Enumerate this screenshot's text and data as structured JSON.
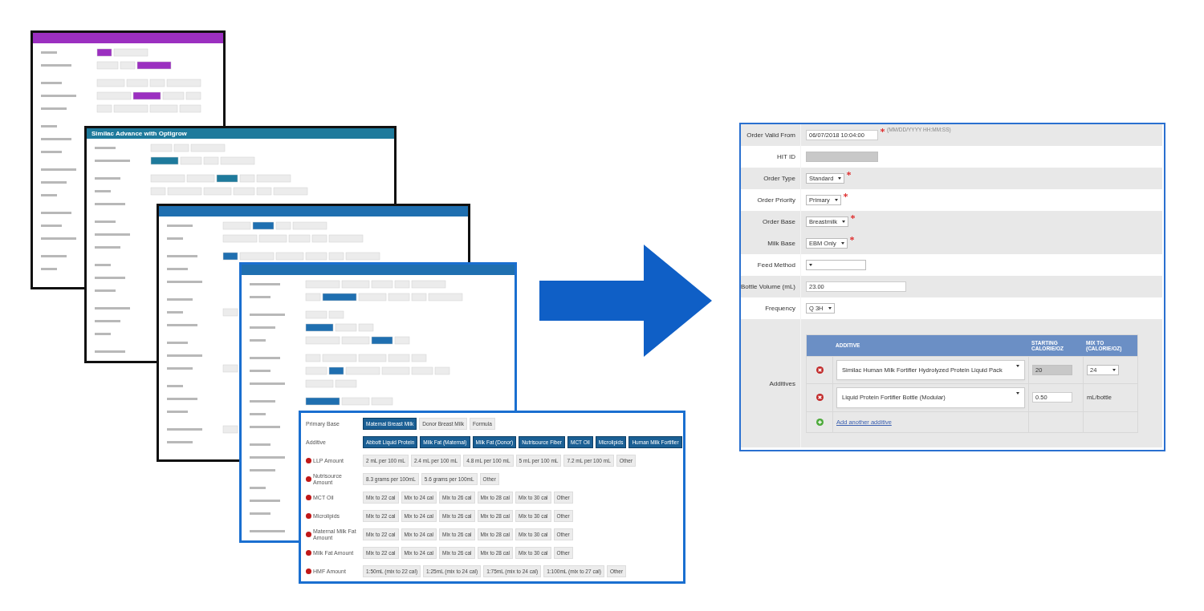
{
  "background_windows": [
    {
      "color": "#9b2fc0"
    },
    {
      "color": "#1e7a9c",
      "title": "Similac Advance with Optigrow"
    },
    {
      "color": "#1f6fb0"
    },
    {
      "color": "#1f6fb0"
    }
  ],
  "additive_window": {
    "rows": [
      {
        "label": "Primary Base",
        "required": false,
        "options": [
          {
            "label": "Maternal Breast Milk",
            "selected": true
          },
          {
            "label": "Donor Breast Milk",
            "selected": false
          },
          {
            "label": "Formula",
            "selected": false
          }
        ]
      },
      {
        "label": "Additive",
        "required": false,
        "options": [
          {
            "label": "Abbott Liquid Protein",
            "selected": true
          },
          {
            "label": "Milk Fat (Maternal)",
            "selected": true
          },
          {
            "label": "Milk Fat (Donor)",
            "selected": true
          },
          {
            "label": "Nutrisource Fiber",
            "selected": true
          },
          {
            "label": "MCT Oil",
            "selected": true
          },
          {
            "label": "Microlipids",
            "selected": true
          },
          {
            "label": "Human Milk Fortifier",
            "selected": true
          }
        ]
      },
      {
        "label": "LLP Amount",
        "required": true,
        "options": [
          {
            "label": "2 mL per 100 mL",
            "selected": false
          },
          {
            "label": "2.4 mL per 100 mL",
            "selected": false
          },
          {
            "label": "4.8 mL per 100 mL",
            "selected": false
          },
          {
            "label": "5 mL per 100 mL",
            "selected": false
          },
          {
            "label": "7.2 mL per 100 mL",
            "selected": false
          },
          {
            "label": "Other",
            "selected": false
          }
        ]
      },
      {
        "label": "Nutrisource Amount",
        "required": true,
        "options": [
          {
            "label": "8.3 grams per 100mL",
            "selected": false
          },
          {
            "label": "5.6 grams per 100mL",
            "selected": false
          },
          {
            "label": "Other",
            "selected": false
          }
        ]
      },
      {
        "label": "MCT Oil",
        "required": true,
        "options": [
          {
            "label": "Mix to 22 cal",
            "selected": false
          },
          {
            "label": "Mix to 24 cal",
            "selected": false
          },
          {
            "label": "Mix to 26 cal",
            "selected": false
          },
          {
            "label": "Mix to 28 cal",
            "selected": false
          },
          {
            "label": "Mix to 30 cal",
            "selected": false
          },
          {
            "label": "Other",
            "selected": false
          }
        ]
      },
      {
        "label": "Microlipids",
        "required": true,
        "options": [
          {
            "label": "Mix to 22 cal",
            "selected": false
          },
          {
            "label": "Mix to 24 cal",
            "selected": false
          },
          {
            "label": "Mix to 26 cal",
            "selected": false
          },
          {
            "label": "Mix to 28 cal",
            "selected": false
          },
          {
            "label": "Mix to 30 cal",
            "selected": false
          },
          {
            "label": "Other",
            "selected": false
          }
        ]
      },
      {
        "label": "Maternal Milk Fat Amount",
        "required": true,
        "options": [
          {
            "label": "Mix to 22 cal",
            "selected": false
          },
          {
            "label": "Mix to 24 cal",
            "selected": false
          },
          {
            "label": "Mix to 26 cal",
            "selected": false
          },
          {
            "label": "Mix to 28 cal",
            "selected": false
          },
          {
            "label": "Mix to 30 cal",
            "selected": false
          },
          {
            "label": "Other",
            "selected": false
          }
        ]
      },
      {
        "label": "Milk Fat Amount",
        "required": true,
        "options": [
          {
            "label": "Mix to 22 cal",
            "selected": false
          },
          {
            "label": "Mix to 24 cal",
            "selected": false
          },
          {
            "label": "Mix to 26 cal",
            "selected": false
          },
          {
            "label": "Mix to 28 cal",
            "selected": false
          },
          {
            "label": "Mix to 30 cal",
            "selected": false
          },
          {
            "label": "Other",
            "selected": false
          }
        ]
      },
      {
        "label": "HMF Amount",
        "required": true,
        "options": [
          {
            "label": "1:50mL (mix to 22 cal)",
            "selected": false
          },
          {
            "label": "1:25mL (mix to 24 cal)",
            "selected": false
          },
          {
            "label": "1:75mL (mix to 24 cal)",
            "selected": false
          },
          {
            "label": "1:100mL (mix to 27 cal)",
            "selected": false
          },
          {
            "label": "Other",
            "selected": false
          }
        ]
      }
    ]
  },
  "order_form": {
    "fields": [
      {
        "kind": "input",
        "label": "Order Valid From",
        "value": "06/07/2018 10:04:00",
        "required": true,
        "hint": "(MM/DD/YYYY HH:MM:SS)",
        "shaded": true
      },
      {
        "kind": "disabled",
        "label": "HIT ID",
        "shaded": false
      },
      {
        "kind": "select",
        "label": "Order Type",
        "value": "Standard",
        "required": true,
        "shaded": true
      },
      {
        "kind": "select",
        "label": "Order Priority",
        "value": "Primary",
        "required": true,
        "shaded": false
      },
      {
        "kind": "select",
        "label": "Order Base",
        "value": "Breastmilk",
        "required": true,
        "shaded": true
      },
      {
        "kind": "select",
        "label": "Milk Base",
        "value": "EBM Only",
        "required": true,
        "shaded": true
      },
      {
        "kind": "select",
        "label": "Feed Method",
        "required": false,
        "shaded": false
      },
      {
        "kind": "input",
        "label": "Bottle Volume (mL)",
        "value": "23.00",
        "required": false,
        "shaded": true
      },
      {
        "kind": "select",
        "label": "Frequency",
        "value": "Q 3H",
        "required": false,
        "shaded": false
      },
      {
        "kind": "additives",
        "label": "Additives",
        "shaded": true
      }
    ],
    "additives": {
      "columns": [
        "ADDITIVE",
        "STARTING CALORIE/OZ",
        "MIX TO (CALORIE/OZ)"
      ],
      "rows": [
        {
          "additive": "Similac Human Milk Fortifier Hydrolyzed Protein Liquid Pack",
          "starting": {
            "kind": "disabled",
            "value": "20"
          },
          "mix_to": {
            "kind": "select",
            "value": "24"
          }
        },
        {
          "additive": "Liquid Protein Fortifier Bottle (Modular)",
          "starting": {
            "kind": "input",
            "value": "0.50"
          },
          "mix_to": {
            "kind": "text",
            "value": "mL/bottle"
          }
        }
      ],
      "add_link": "Add another additive"
    }
  }
}
